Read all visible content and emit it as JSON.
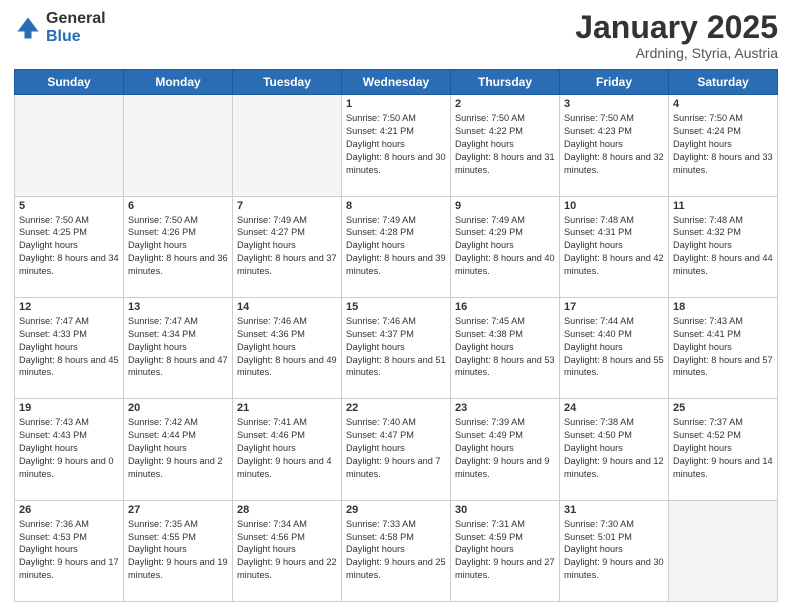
{
  "header": {
    "logo_general": "General",
    "logo_blue": "Blue",
    "month_title": "January 2025",
    "location": "Ardning, Styria, Austria"
  },
  "days_of_week": [
    "Sunday",
    "Monday",
    "Tuesday",
    "Wednesday",
    "Thursday",
    "Friday",
    "Saturday"
  ],
  "weeks": [
    [
      {
        "day": "",
        "empty": true
      },
      {
        "day": "",
        "empty": true
      },
      {
        "day": "",
        "empty": true
      },
      {
        "day": "1",
        "sunrise": "7:50 AM",
        "sunset": "4:21 PM",
        "daylight": "8 hours and 30 minutes."
      },
      {
        "day": "2",
        "sunrise": "7:50 AM",
        "sunset": "4:22 PM",
        "daylight": "8 hours and 31 minutes."
      },
      {
        "day": "3",
        "sunrise": "7:50 AM",
        "sunset": "4:23 PM",
        "daylight": "8 hours and 32 minutes."
      },
      {
        "day": "4",
        "sunrise": "7:50 AM",
        "sunset": "4:24 PM",
        "daylight": "8 hours and 33 minutes."
      }
    ],
    [
      {
        "day": "5",
        "sunrise": "7:50 AM",
        "sunset": "4:25 PM",
        "daylight": "8 hours and 34 minutes."
      },
      {
        "day": "6",
        "sunrise": "7:50 AM",
        "sunset": "4:26 PM",
        "daylight": "8 hours and 36 minutes."
      },
      {
        "day": "7",
        "sunrise": "7:49 AM",
        "sunset": "4:27 PM",
        "daylight": "8 hours and 37 minutes."
      },
      {
        "day": "8",
        "sunrise": "7:49 AM",
        "sunset": "4:28 PM",
        "daylight": "8 hours and 39 minutes."
      },
      {
        "day": "9",
        "sunrise": "7:49 AM",
        "sunset": "4:29 PM",
        "daylight": "8 hours and 40 minutes."
      },
      {
        "day": "10",
        "sunrise": "7:48 AM",
        "sunset": "4:31 PM",
        "daylight": "8 hours and 42 minutes."
      },
      {
        "day": "11",
        "sunrise": "7:48 AM",
        "sunset": "4:32 PM",
        "daylight": "8 hours and 44 minutes."
      }
    ],
    [
      {
        "day": "12",
        "sunrise": "7:47 AM",
        "sunset": "4:33 PM",
        "daylight": "8 hours and 45 minutes."
      },
      {
        "day": "13",
        "sunrise": "7:47 AM",
        "sunset": "4:34 PM",
        "daylight": "8 hours and 47 minutes."
      },
      {
        "day": "14",
        "sunrise": "7:46 AM",
        "sunset": "4:36 PM",
        "daylight": "8 hours and 49 minutes."
      },
      {
        "day": "15",
        "sunrise": "7:46 AM",
        "sunset": "4:37 PM",
        "daylight": "8 hours and 51 minutes."
      },
      {
        "day": "16",
        "sunrise": "7:45 AM",
        "sunset": "4:38 PM",
        "daylight": "8 hours and 53 minutes."
      },
      {
        "day": "17",
        "sunrise": "7:44 AM",
        "sunset": "4:40 PM",
        "daylight": "8 hours and 55 minutes."
      },
      {
        "day": "18",
        "sunrise": "7:43 AM",
        "sunset": "4:41 PM",
        "daylight": "8 hours and 57 minutes."
      }
    ],
    [
      {
        "day": "19",
        "sunrise": "7:43 AM",
        "sunset": "4:43 PM",
        "daylight": "9 hours and 0 minutes."
      },
      {
        "day": "20",
        "sunrise": "7:42 AM",
        "sunset": "4:44 PM",
        "daylight": "9 hours and 2 minutes."
      },
      {
        "day": "21",
        "sunrise": "7:41 AM",
        "sunset": "4:46 PM",
        "daylight": "9 hours and 4 minutes."
      },
      {
        "day": "22",
        "sunrise": "7:40 AM",
        "sunset": "4:47 PM",
        "daylight": "9 hours and 7 minutes."
      },
      {
        "day": "23",
        "sunrise": "7:39 AM",
        "sunset": "4:49 PM",
        "daylight": "9 hours and 9 minutes."
      },
      {
        "day": "24",
        "sunrise": "7:38 AM",
        "sunset": "4:50 PM",
        "daylight": "9 hours and 12 minutes."
      },
      {
        "day": "25",
        "sunrise": "7:37 AM",
        "sunset": "4:52 PM",
        "daylight": "9 hours and 14 minutes."
      }
    ],
    [
      {
        "day": "26",
        "sunrise": "7:36 AM",
        "sunset": "4:53 PM",
        "daylight": "9 hours and 17 minutes."
      },
      {
        "day": "27",
        "sunrise": "7:35 AM",
        "sunset": "4:55 PM",
        "daylight": "9 hours and 19 minutes."
      },
      {
        "day": "28",
        "sunrise": "7:34 AM",
        "sunset": "4:56 PM",
        "daylight": "9 hours and 22 minutes."
      },
      {
        "day": "29",
        "sunrise": "7:33 AM",
        "sunset": "4:58 PM",
        "daylight": "9 hours and 25 minutes."
      },
      {
        "day": "30",
        "sunrise": "7:31 AM",
        "sunset": "4:59 PM",
        "daylight": "9 hours and 27 minutes."
      },
      {
        "day": "31",
        "sunrise": "7:30 AM",
        "sunset": "5:01 PM",
        "daylight": "9 hours and 30 minutes."
      },
      {
        "day": "",
        "empty": true
      }
    ]
  ]
}
